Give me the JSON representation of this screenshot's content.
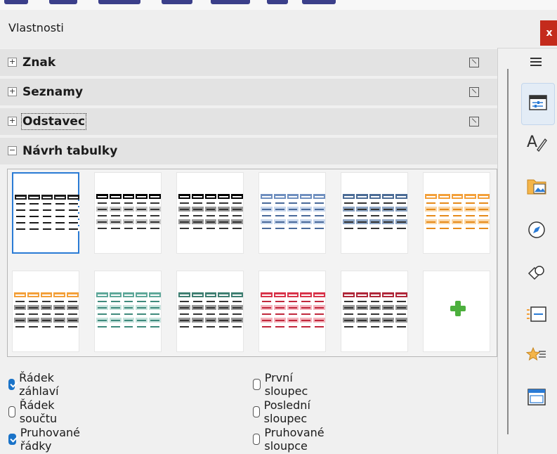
{
  "window": {
    "title": "Vlastnosti",
    "close_label": "x"
  },
  "sections": [
    {
      "label": "Znak",
      "expander": "+",
      "state": "collapsed"
    },
    {
      "label": "Seznamy",
      "expander": "+",
      "state": "collapsed"
    },
    {
      "label": "Odstavec",
      "expander": "+",
      "state": "collapsed"
    },
    {
      "label": "Návrh tabulky",
      "expander": "−",
      "state": "expanded"
    }
  ],
  "table_styles": [
    {
      "name": "default-style",
      "header": "#1b1b1b",
      "band": "#ffffff",
      "text": "#1b1b1b",
      "selected": true
    },
    {
      "name": "black-header",
      "header": "#000000",
      "band": "#c8c8c8",
      "text": "#333333"
    },
    {
      "name": "black-header-dark",
      "header": "#000000",
      "band": "#9a9a9a",
      "text": "#333333"
    },
    {
      "name": "light-blue",
      "header": "#6f8fbf",
      "band": "#c9d8ee",
      "text": "#4a6a9a"
    },
    {
      "name": "dark-blue",
      "header": "#4a6b95",
      "band": "#8fa6c4",
      "text": "#333333"
    },
    {
      "name": "orange",
      "header": "#f3a03a",
      "band": "#fbd8a8",
      "text": "#e58a1a"
    },
    {
      "name": "orange-gray",
      "header": "#f3a03a",
      "band": "#9a9a9a",
      "text": "#333333"
    },
    {
      "name": "teal",
      "header": "#5fa89a",
      "band": "#c8e4de",
      "text": "#3f8a7c"
    },
    {
      "name": "dark-teal",
      "header": "#3f7f72",
      "band": "#9a9a9a",
      "text": "#333333"
    },
    {
      "name": "red",
      "header": "#d8344a",
      "band": "#f5b6bf",
      "text": "#c0283c"
    },
    {
      "name": "dark-red",
      "header": "#b0283a",
      "band": "#9a9a9a",
      "text": "#333333"
    },
    {
      "name": "add-new-style",
      "add": true
    }
  ],
  "options": [
    {
      "label": "Řádek záhlaví",
      "checked": true
    },
    {
      "label": "První sloupec",
      "checked": false
    },
    {
      "label": "Řádek součtu",
      "checked": false
    },
    {
      "label": "Poslední sloupec",
      "checked": false
    },
    {
      "label": "Pruhované řádky",
      "checked": true
    },
    {
      "label": "Pruhované sloupce",
      "checked": false
    }
  ],
  "sidebar_tabs": [
    {
      "icon": "menu-icon"
    },
    {
      "icon": "properties-icon",
      "active": true
    },
    {
      "icon": "styles-icon"
    },
    {
      "icon": "gallery-icon"
    },
    {
      "icon": "navigator-icon"
    },
    {
      "icon": "shapes-icon"
    },
    {
      "icon": "page-icon"
    },
    {
      "icon": "style-inspector-icon"
    },
    {
      "icon": "manage-changes-icon"
    }
  ]
}
